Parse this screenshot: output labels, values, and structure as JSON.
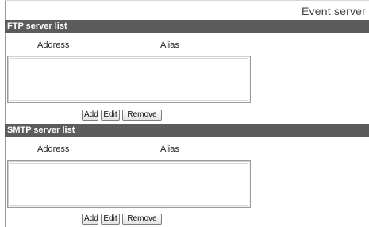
{
  "header": {
    "title": "Event server"
  },
  "ftp": {
    "heading": "FTP server list",
    "columns": {
      "address": "Address",
      "alias": "Alias"
    },
    "buttons": {
      "add": "Add",
      "edit": "Edit",
      "remove": "Remove"
    }
  },
  "smtp": {
    "heading": "SMTP server list",
    "columns": {
      "address": "Address",
      "alias": "Alias"
    },
    "buttons": {
      "add": "Add",
      "edit": "Edit",
      "remove": "Remove"
    }
  }
}
